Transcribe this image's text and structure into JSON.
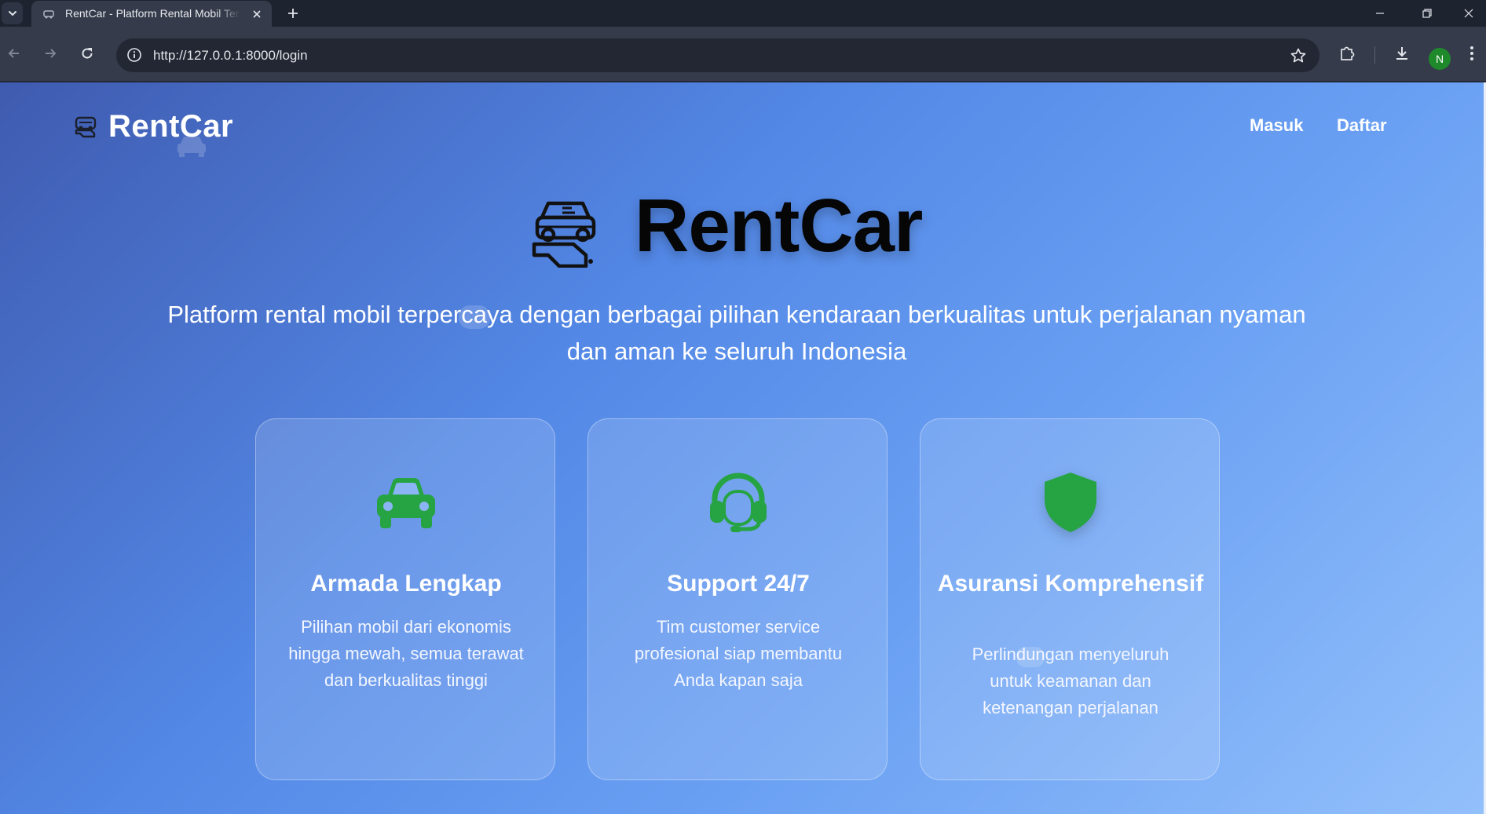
{
  "browser": {
    "tab_title": "RentCar - Platform Rental Mobil Terpercaya",
    "url": "http://127.0.0.1:8000/login",
    "profile_initial": "N"
  },
  "nav": {
    "brand": "RentCar",
    "links": [
      "Masuk",
      "Daftar"
    ]
  },
  "hero": {
    "title": "RentCar",
    "subtitle": "Platform rental mobil terpercaya dengan berbagai pilihan kendaraan berkualitas untuk perjalanan nyaman dan aman ke seluruh Indonesia"
  },
  "features": [
    {
      "icon": "car-icon",
      "title": "Armada Lengkap",
      "text": "Pilihan mobil dari ekonomis hingga mewah, semua terawat dan berkualitas tinggi"
    },
    {
      "icon": "headset-icon",
      "title": "Support 24/7",
      "text": "Tim customer service profesional siap membantu Anda kapan saja"
    },
    {
      "icon": "shield-icon",
      "title": "Asuransi Komprehensif",
      "text": "Perlindungan menyeluruh untuk keamanan dan ketenangan perjalanan"
    }
  ],
  "colors": {
    "icon_green": "#26a343",
    "text_white": "#ffffff",
    "hero_title": "#060606"
  }
}
